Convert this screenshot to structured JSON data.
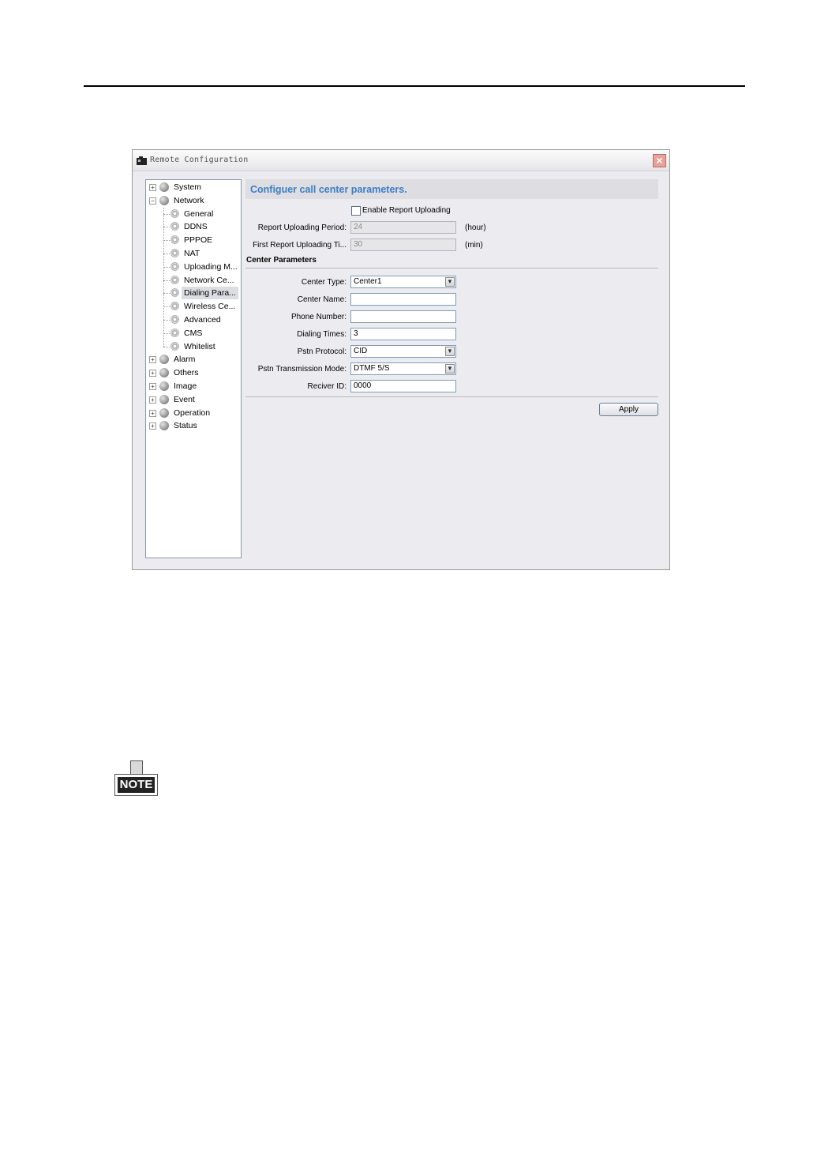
{
  "window": {
    "title": "Remote Configuration",
    "close_symbol": "×"
  },
  "tree": {
    "items": [
      {
        "label": "System",
        "icon": "globe-icon",
        "expander": "+"
      },
      {
        "label": "Network",
        "icon": "globe-icon",
        "expander": "−"
      },
      {
        "label": "General",
        "icon": "gear-icon"
      },
      {
        "label": "DDNS",
        "icon": "gear-icon"
      },
      {
        "label": "PPPOE",
        "icon": "gear-icon"
      },
      {
        "label": "NAT",
        "icon": "gear-icon"
      },
      {
        "label": "Uploading M...",
        "icon": "gear-icon"
      },
      {
        "label": "Network Ce...",
        "icon": "gear-icon"
      },
      {
        "label": "Dialing Para...",
        "icon": "gear-icon",
        "selected": true
      },
      {
        "label": "Wireless Ce...",
        "icon": "gear-icon"
      },
      {
        "label": "Advanced",
        "icon": "gear-icon"
      },
      {
        "label": "CMS",
        "icon": "gear-icon"
      },
      {
        "label": "Whitelist",
        "icon": "gear-icon"
      },
      {
        "label": "Alarm",
        "icon": "globe-icon",
        "expander": "+"
      },
      {
        "label": "Others",
        "icon": "globe-icon",
        "expander": "+"
      },
      {
        "label": "Image",
        "icon": "globe-icon",
        "expander": "+"
      },
      {
        "label": "Event",
        "icon": "globe-icon",
        "expander": "+"
      },
      {
        "label": "Operation",
        "icon": "globe-icon",
        "expander": "+"
      },
      {
        "label": "Status",
        "icon": "globe-icon",
        "expander": "+"
      }
    ]
  },
  "panel": {
    "header": "Configuer call center parameters.",
    "enable_report": {
      "label": "Enable Report Uploading",
      "checked": false
    },
    "report_period": {
      "label": "Report Uploading Period:",
      "value": "24",
      "unit": "(hour)"
    },
    "first_report": {
      "label": "First Report Uploading Ti...",
      "value": "30",
      "unit": "(min)"
    },
    "section_title": "Center Parameters",
    "center_type": {
      "label": "Center Type:",
      "value": "Center1"
    },
    "center_name": {
      "label": "Center Name:",
      "value": ""
    },
    "phone_number": {
      "label": "Phone Number:",
      "value": ""
    },
    "dialing_times": {
      "label": "Dialing Times:",
      "value": "3"
    },
    "pstn_protocol": {
      "label": "Pstn Protocol:",
      "value": "CID"
    },
    "pstn_mode": {
      "label": "Pstn Transmission Mode:",
      "value": "DTMF 5/S"
    },
    "reciver_id": {
      "label": "Reciver ID:",
      "value": "0000"
    },
    "apply_label": "Apply",
    "dropdown_arrow": "▼"
  },
  "note": {
    "label": "NOTE"
  }
}
